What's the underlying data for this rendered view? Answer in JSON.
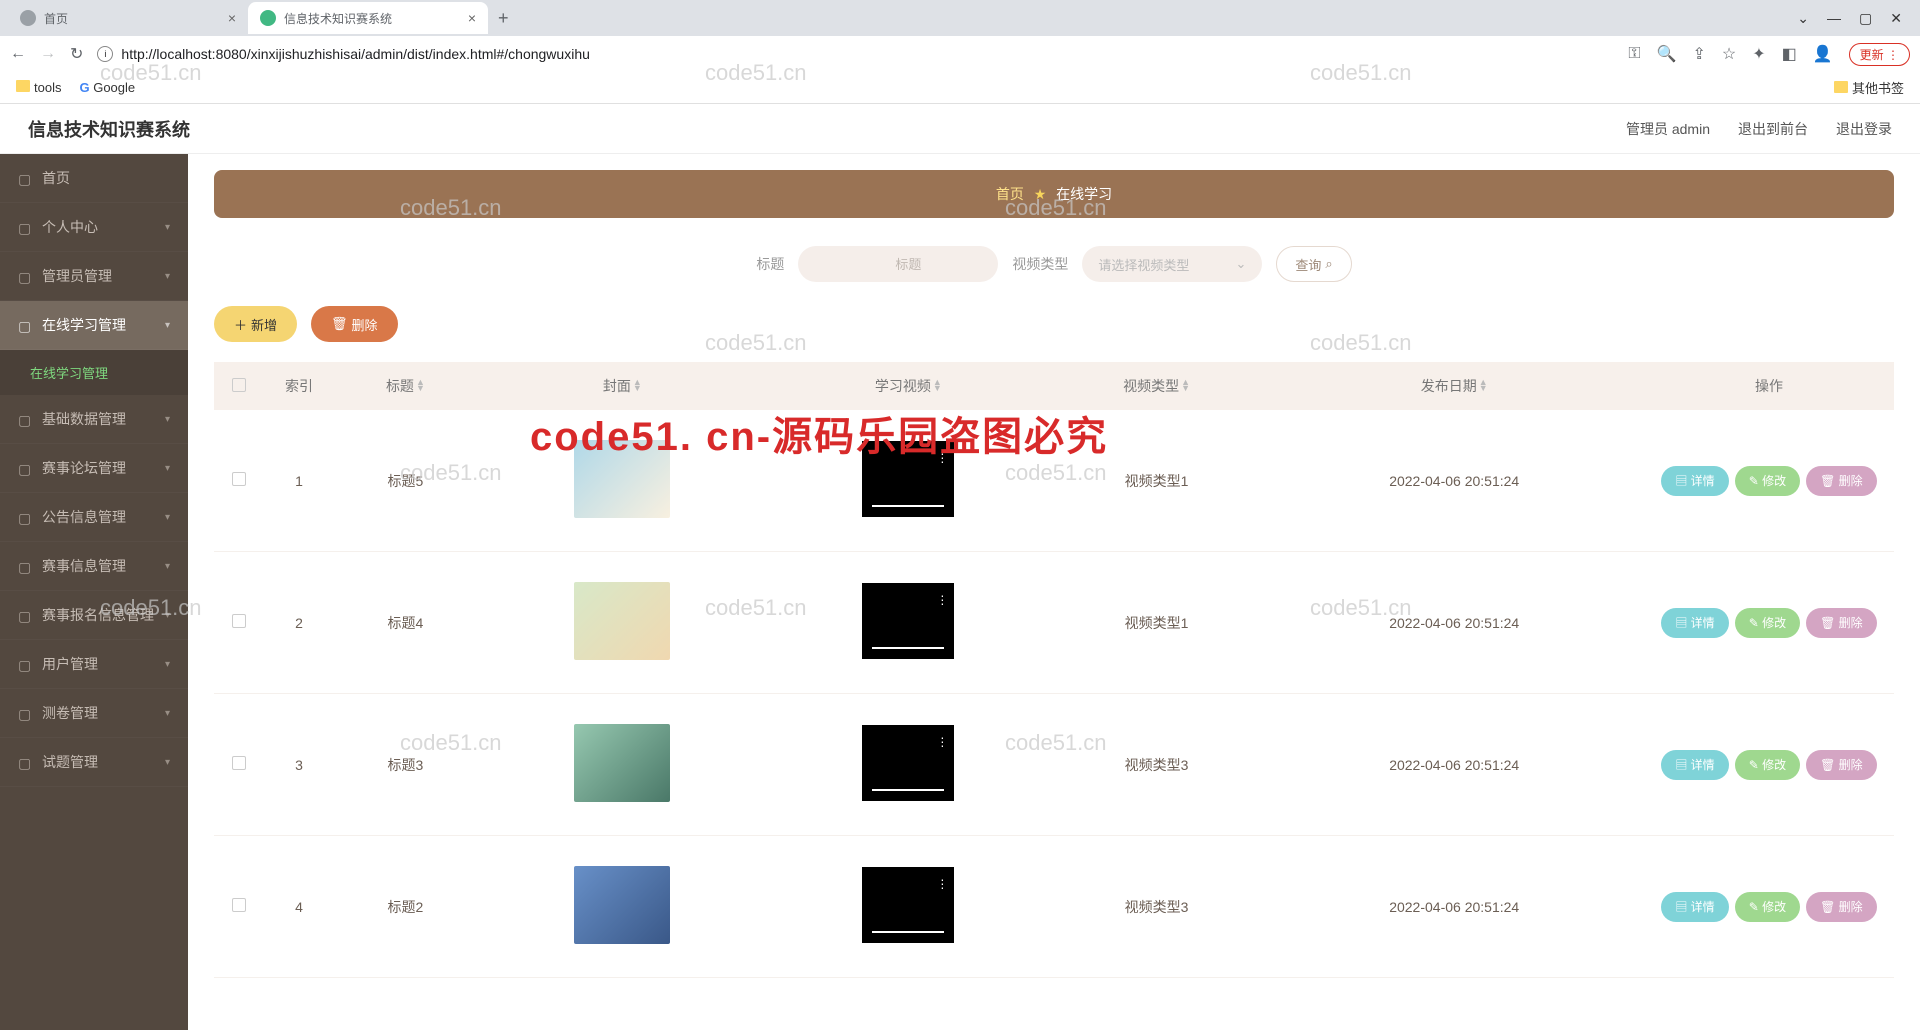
{
  "browser": {
    "tab1": "首页",
    "tab2": "信息技术知识赛系统",
    "url": "http://localhost:8080/xinxijishuzhishisai/admin/dist/index.html#/chongwuxihu",
    "update": "更新",
    "bookmarks": {
      "tools": "tools",
      "google": "Google",
      "other": "其他书签"
    }
  },
  "header": {
    "title": "信息技术知识赛系统",
    "user": "管理员 admin",
    "front": "退出到前台",
    "logout": "退出登录"
  },
  "sidebar": {
    "items": [
      {
        "label": "首页",
        "expandable": false
      },
      {
        "label": "个人中心",
        "expandable": true
      },
      {
        "label": "管理员管理",
        "expandable": true
      },
      {
        "label": "在线学习管理",
        "expandable": true,
        "active": true,
        "sub": "在线学习管理"
      },
      {
        "label": "基础数据管理",
        "expandable": true
      },
      {
        "label": "赛事论坛管理",
        "expandable": true
      },
      {
        "label": "公告信息管理",
        "expandable": true
      },
      {
        "label": "赛事信息管理",
        "expandable": true
      },
      {
        "label": "赛事报名信息管理",
        "expandable": true
      },
      {
        "label": "用户管理",
        "expandable": true
      },
      {
        "label": "测卷管理",
        "expandable": true
      },
      {
        "label": "试题管理",
        "expandable": true
      }
    ]
  },
  "breadcrumb": {
    "home": "首页",
    "current": "在线学习"
  },
  "search": {
    "title_label": "标题",
    "title_placeholder": "标题",
    "type_label": "视频类型",
    "type_placeholder": "请选择视频类型",
    "query_btn": "查询"
  },
  "actions": {
    "add": "新增",
    "delete": "删除"
  },
  "table": {
    "headers": {
      "index": "索引",
      "title": "标题",
      "cover": "封面",
      "video": "学习视频",
      "type": "视频类型",
      "date": "发布日期",
      "ops": "操作"
    },
    "op_labels": {
      "detail": "详情",
      "edit": "修改",
      "delete": "删除"
    },
    "rows": [
      {
        "index": "1",
        "title": "标题5",
        "type": "视频类型1",
        "date": "2022-04-06 20:51:24"
      },
      {
        "index": "2",
        "title": "标题4",
        "type": "视频类型1",
        "date": "2022-04-06 20:51:24"
      },
      {
        "index": "3",
        "title": "标题3",
        "type": "视频类型3",
        "date": "2022-04-06 20:51:24"
      },
      {
        "index": "4",
        "title": "标题2",
        "type": "视频类型3",
        "date": "2022-04-06 20:51:24"
      }
    ]
  },
  "watermark": "code51.cn",
  "big_watermark": "code51. cn-源码乐园盗图必究"
}
